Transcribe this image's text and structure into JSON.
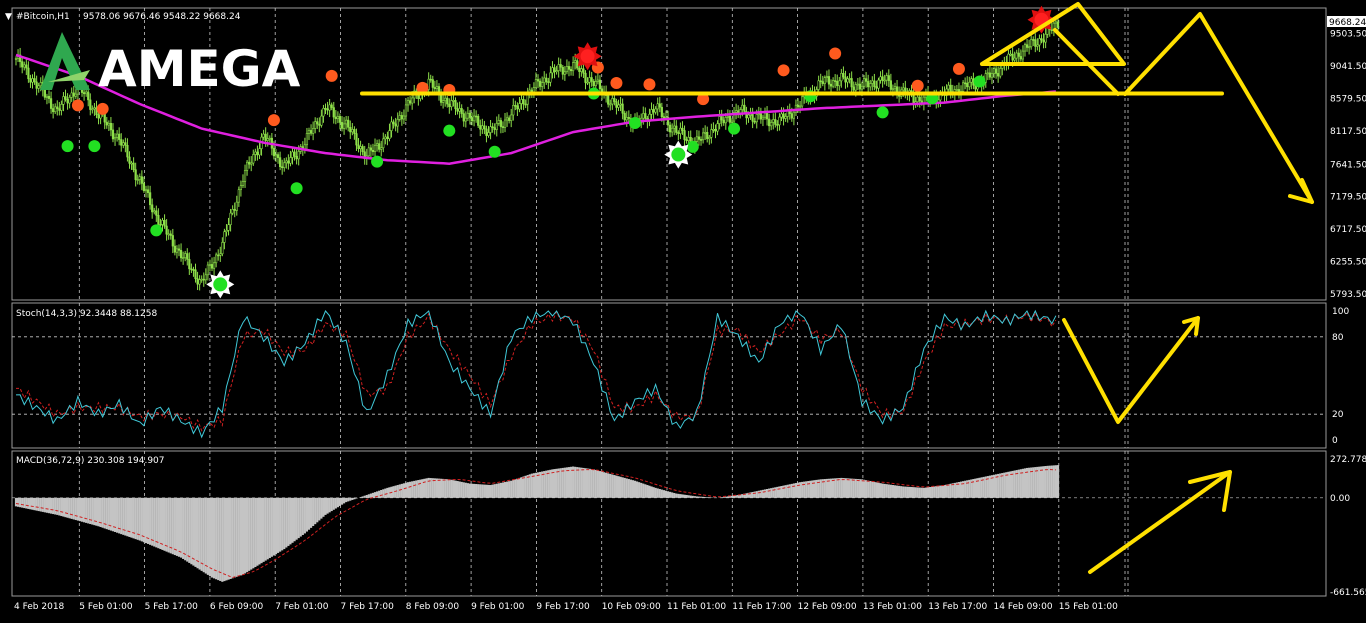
{
  "header": {
    "symbol": "#Bitcoin,H1",
    "ohlc": "9578.06 9676.46 9548.22 9668.24"
  },
  "logo": {
    "text": "AMEGA"
  },
  "colors": {
    "background": "#000000",
    "candle": "#8ee04a",
    "ma": "#e020e0",
    "support": "#ffe000",
    "buy_signal": "#22e022",
    "sell_signal": "#ff5a1e",
    "stoch_main": "#40c8d8",
    "stoch_signal": "#d02020",
    "macd_hist": "#c4c4c4"
  },
  "chart_data": [
    {
      "type": "candlestick",
      "panel": "price",
      "symbol": "#Bitcoin,H1",
      "last_price_label": "9668.24",
      "y_ticks": [
        "9503.50",
        "9041.50",
        "8579.50",
        "8117.50",
        "7641.50",
        "7179.50",
        "6717.50",
        "6255.50",
        "5793.50"
      ],
      "ylim": [
        5793.5,
        9800
      ],
      "close_path": [
        [
          0,
          9150
        ],
        [
          10,
          8780
        ],
        [
          20,
          8400
        ],
        [
          30,
          8750
        ],
        [
          40,
          8350
        ],
        [
          50,
          8000
        ],
        [
          60,
          7400
        ],
        [
          70,
          6800
        ],
        [
          80,
          6350
        ],
        [
          90,
          5950
        ],
        [
          100,
          6500
        ],
        [
          110,
          7450
        ],
        [
          120,
          8050
        ],
        [
          130,
          7600
        ],
        [
          140,
          7950
        ],
        [
          150,
          8450
        ],
        [
          160,
          8200
        ],
        [
          170,
          7750
        ],
        [
          180,
          8050
        ],
        [
          190,
          8500
        ],
        [
          200,
          8800
        ],
        [
          210,
          8500
        ],
        [
          220,
          8300
        ],
        [
          230,
          8100
        ],
        [
          240,
          8350
        ],
        [
          250,
          8700
        ],
        [
          260,
          8950
        ],
        [
          270,
          9050
        ],
        [
          280,
          8800
        ],
        [
          290,
          8500
        ],
        [
          300,
          8200
        ],
        [
          310,
          8450
        ],
        [
          320,
          8100
        ],
        [
          330,
          7950
        ],
        [
          340,
          8200
        ],
        [
          350,
          8400
        ],
        [
          360,
          8300
        ],
        [
          370,
          8250
        ],
        [
          380,
          8500
        ],
        [
          390,
          8800
        ],
        [
          400,
          8850
        ],
        [
          410,
          8750
        ],
        [
          420,
          8850
        ],
        [
          430,
          8650
        ],
        [
          440,
          8550
        ],
        [
          450,
          8650
        ],
        [
          460,
          8750
        ],
        [
          470,
          8850
        ],
        [
          480,
          9100
        ],
        [
          490,
          9300
        ],
        [
          500,
          9500
        ],
        [
          505,
          9668
        ]
      ],
      "moving_average": [
        [
          0,
          9200
        ],
        [
          30,
          8900
        ],
        [
          60,
          8500
        ],
        [
          90,
          8150
        ],
        [
          120,
          7950
        ],
        [
          150,
          7800
        ],
        [
          180,
          7700
        ],
        [
          210,
          7650
        ],
        [
          240,
          7800
        ],
        [
          270,
          8100
        ],
        [
          300,
          8250
        ],
        [
          330,
          8320
        ],
        [
          360,
          8380
        ],
        [
          390,
          8440
        ],
        [
          420,
          8480
        ],
        [
          450,
          8520
        ],
        [
          480,
          8620
        ],
        [
          505,
          8680
        ]
      ],
      "support_level": 8650,
      "buy_signals": [
        [
          25,
          7900
        ],
        [
          38,
          7900
        ],
        [
          68,
          6700
        ],
        [
          99,
          5930
        ],
        [
          136,
          7300
        ],
        [
          175,
          7680
        ],
        [
          210,
          8120
        ],
        [
          232,
          7820
        ],
        [
          280,
          8650
        ],
        [
          300,
          8230
        ],
        [
          328,
          7890
        ],
        [
          348,
          8150
        ],
        [
          385,
          8610
        ],
        [
          420,
          8380
        ],
        [
          444,
          8580
        ],
        [
          467,
          8820
        ]
      ],
      "sell_signals": [
        [
          30,
          8480
        ],
        [
          42,
          8430
        ],
        [
          125,
          8270
        ],
        [
          153,
          8900
        ],
        [
          197,
          8730
        ],
        [
          210,
          8700
        ],
        [
          282,
          9020
        ],
        [
          291,
          8800
        ],
        [
          307,
          8780
        ],
        [
          333,
          8570
        ],
        [
          372,
          8980
        ],
        [
          397,
          9220
        ],
        [
          437,
          8760
        ],
        [
          457,
          9000
        ]
      ],
      "star_signals": [
        {
          "x": 99,
          "y": 5930,
          "kind": "buy"
        },
        {
          "x": 321,
          "y": 7780,
          "kind": "buy"
        },
        {
          "x": 277,
          "y": 9180,
          "kind": "sell"
        },
        {
          "x": 497,
          "y": 9700,
          "kind": "sell"
        }
      ]
    },
    {
      "type": "line",
      "panel": "stochastic",
      "title": "Stoch(14,3,3) 92.3448 88.1258",
      "y_ticks": [
        "100",
        "80",
        "20",
        "0"
      ],
      "ylim": [
        0,
        100
      ],
      "levels": [
        80,
        20
      ],
      "series": [
        {
          "role": "main",
          "values": [
            [
              0,
              35
            ],
            [
              10,
              25
            ],
            [
              20,
              15
            ],
            [
              30,
              30
            ],
            [
              40,
              20
            ],
            [
              50,
              28
            ],
            [
              60,
              12
            ],
            [
              70,
              25
            ],
            [
              80,
              15
            ],
            [
              90,
              5
            ],
            [
              100,
              25
            ],
            [
              110,
              95
            ],
            [
              120,
              80
            ],
            [
              130,
              60
            ],
            [
              140,
              75
            ],
            [
              150,
              100
            ],
            [
              160,
              75
            ],
            [
              170,
              20
            ],
            [
              180,
              50
            ],
            [
              190,
              90
            ],
            [
              200,
              100
            ],
            [
              210,
              60
            ],
            [
              220,
              40
            ],
            [
              230,
              20
            ],
            [
              240,
              80
            ],
            [
              250,
              95
            ],
            [
              260,
              100
            ],
            [
              270,
              92
            ],
            [
              280,
              60
            ],
            [
              290,
              15
            ],
            [
              300,
              30
            ],
            [
              310,
              40
            ],
            [
              320,
              10
            ],
            [
              330,
              20
            ],
            [
              340,
              95
            ],
            [
              350,
              80
            ],
            [
              360,
              60
            ],
            [
              370,
              90
            ],
            [
              380,
              100
            ],
            [
              390,
              70
            ],
            [
              400,
              90
            ],
            [
              410,
              30
            ],
            [
              420,
              15
            ],
            [
              430,
              25
            ],
            [
              440,
              70
            ],
            [
              450,
              95
            ],
            [
              460,
              88
            ],
            [
              470,
              97
            ],
            [
              480,
              92
            ],
            [
              490,
              98
            ],
            [
              500,
              94
            ],
            [
              505,
              92
            ]
          ]
        },
        {
          "role": "signal",
          "values": [
            [
              0,
              40
            ],
            [
              10,
              30
            ],
            [
              20,
              20
            ],
            [
              30,
              25
            ],
            [
              40,
              25
            ],
            [
              50,
              25
            ],
            [
              60,
              18
            ],
            [
              70,
              20
            ],
            [
              80,
              18
            ],
            [
              90,
              10
            ],
            [
              100,
              15
            ],
            [
              110,
              80
            ],
            [
              120,
              85
            ],
            [
              130,
              68
            ],
            [
              140,
              70
            ],
            [
              150,
              90
            ],
            [
              160,
              82
            ],
            [
              170,
              35
            ],
            [
              180,
              40
            ],
            [
              190,
              80
            ],
            [
              200,
              95
            ],
            [
              210,
              70
            ],
            [
              220,
              50
            ],
            [
              230,
              28
            ],
            [
              240,
              65
            ],
            [
              250,
              90
            ],
            [
              260,
              96
            ],
            [
              270,
              94
            ],
            [
              280,
              70
            ],
            [
              290,
              25
            ],
            [
              300,
              25
            ],
            [
              310,
              35
            ],
            [
              320,
              18
            ],
            [
              330,
              18
            ],
            [
              340,
              85
            ],
            [
              350,
              85
            ],
            [
              360,
              68
            ],
            [
              370,
              82
            ],
            [
              380,
              95
            ],
            [
              390,
              78
            ],
            [
              400,
              85
            ],
            [
              410,
              40
            ],
            [
              420,
              20
            ],
            [
              430,
              22
            ],
            [
              440,
              60
            ],
            [
              450,
              88
            ],
            [
              460,
              90
            ],
            [
              470,
              94
            ],
            [
              480,
              93
            ],
            [
              490,
              96
            ],
            [
              500,
              93
            ],
            [
              505,
              88
            ]
          ]
        }
      ]
    },
    {
      "type": "bar",
      "panel": "macd",
      "title": "MACD(36,72,9) 230.308 194.907",
      "y_ticks": [
        "272.778",
        "0.00",
        "-661.565"
      ],
      "ylim": [
        -661.565,
        272.778
      ],
      "histogram": [
        [
          0,
          -60
        ],
        [
          20,
          -120
        ],
        [
          40,
          -200
        ],
        [
          60,
          -300
        ],
        [
          80,
          -420
        ],
        [
          95,
          -560
        ],
        [
          100,
          -590
        ],
        [
          110,
          -540
        ],
        [
          120,
          -450
        ],
        [
          130,
          -360
        ],
        [
          140,
          -250
        ],
        [
          150,
          -120
        ],
        [
          160,
          -30
        ],
        [
          170,
          20
        ],
        [
          180,
          70
        ],
        [
          190,
          110
        ],
        [
          200,
          140
        ],
        [
          210,
          130
        ],
        [
          220,
          100
        ],
        [
          230,
          90
        ],
        [
          240,
          120
        ],
        [
          250,
          170
        ],
        [
          260,
          200
        ],
        [
          270,
          220
        ],
        [
          280,
          200
        ],
        [
          290,
          160
        ],
        [
          300,
          120
        ],
        [
          310,
          70
        ],
        [
          320,
          30
        ],
        [
          330,
          10
        ],
        [
          340,
          0
        ],
        [
          350,
          20
        ],
        [
          360,
          50
        ],
        [
          370,
          80
        ],
        [
          380,
          110
        ],
        [
          390,
          130
        ],
        [
          400,
          140
        ],
        [
          410,
          130
        ],
        [
          420,
          100
        ],
        [
          430,
          80
        ],
        [
          440,
          70
        ],
        [
          450,
          90
        ],
        [
          460,
          120
        ],
        [
          470,
          150
        ],
        [
          480,
          180
        ],
        [
          490,
          210
        ],
        [
          500,
          225
        ],
        [
          505,
          230
        ]
      ],
      "signal": [
        [
          0,
          -40
        ],
        [
          20,
          -90
        ],
        [
          40,
          -170
        ],
        [
          60,
          -260
        ],
        [
          80,
          -380
        ],
        [
          95,
          -500
        ],
        [
          105,
          -560
        ],
        [
          115,
          -520
        ],
        [
          125,
          -440
        ],
        [
          140,
          -300
        ],
        [
          155,
          -130
        ],
        [
          170,
          -10
        ],
        [
          185,
          50
        ],
        [
          200,
          120
        ],
        [
          215,
          130
        ],
        [
          230,
          100
        ],
        [
          250,
          150
        ],
        [
          265,
          190
        ],
        [
          280,
          200
        ],
        [
          300,
          140
        ],
        [
          320,
          50
        ],
        [
          340,
          5
        ],
        [
          360,
          35
        ],
        [
          380,
          90
        ],
        [
          400,
          130
        ],
        [
          420,
          110
        ],
        [
          440,
          75
        ],
        [
          460,
          100
        ],
        [
          480,
          160
        ],
        [
          500,
          200
        ],
        [
          505,
          195
        ]
      ]
    }
  ],
  "x_axis": {
    "labels": [
      "4 Feb 2018",
      "5 Feb 01:00",
      "5 Feb 17:00",
      "6 Feb 09:00",
      "7 Feb 01:00",
      "7 Feb 17:00",
      "8 Feb 09:00",
      "9 Feb 01:00",
      "9 Feb 17:00",
      "10 Feb 09:00",
      "11 Feb 01:00",
      "11 Feb 17:00",
      "12 Feb 09:00",
      "13 Feb 01:00",
      "13 Feb 17:00",
      "14 Feb 09:00",
      "15 Feb 01:00"
    ]
  }
}
